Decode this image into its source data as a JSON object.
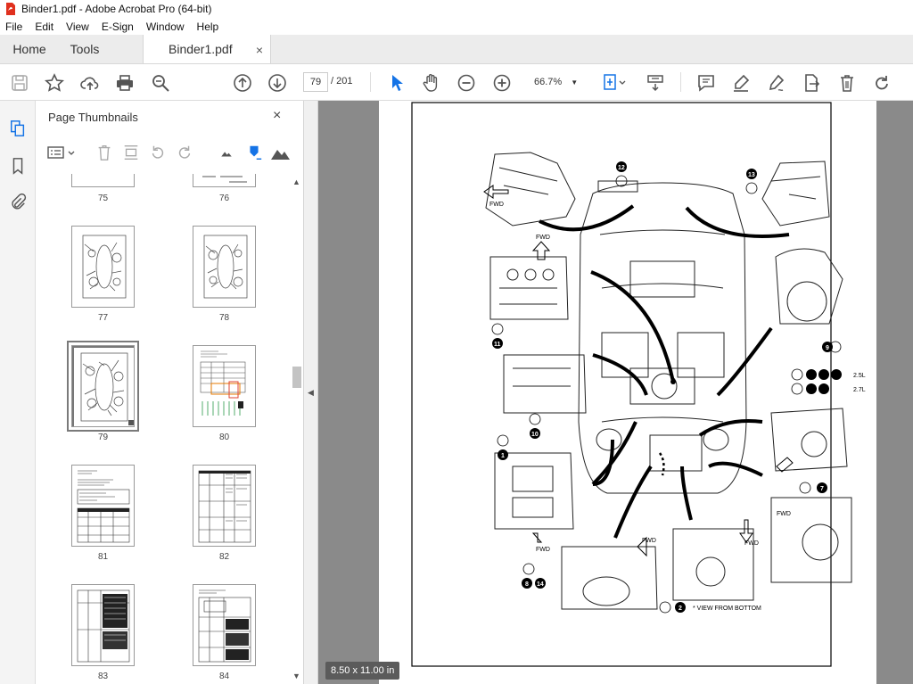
{
  "window": {
    "title": "Binder1.pdf - Adobe Acrobat Pro (64-bit)"
  },
  "menu": [
    "File",
    "Edit",
    "View",
    "E-Sign",
    "Window",
    "Help"
  ],
  "tabs": {
    "home": "Home",
    "tools": "Tools",
    "document": "Binder1.pdf",
    "close": "×"
  },
  "toolbar": {
    "page_current": "79",
    "page_total": "/ 201",
    "zoom": "66.7%"
  },
  "panel": {
    "title": "Page Thumbnails",
    "close": "×",
    "thumbnails": [
      {
        "label": "75"
      },
      {
        "label": "76"
      },
      {
        "label": "77"
      },
      {
        "label": "78"
      },
      {
        "label": "79",
        "selected": true
      },
      {
        "label": "80"
      },
      {
        "label": "81"
      },
      {
        "label": "82"
      },
      {
        "label": "83"
      },
      {
        "label": "84"
      }
    ]
  },
  "page_size": "8.50 x 11.00 in",
  "diagram": {
    "fwd": "FWD",
    "view_note": "* VIEW FROM BOTTOM",
    "labels": [
      "12",
      "13",
      "11",
      "9",
      "10",
      "1",
      "7",
      "2",
      "8",
      "14"
    ],
    "engine_2_5": "2.5L",
    "engine_2_7": "2.7L"
  },
  "colors": {
    "accent": "#1473e6",
    "toolbar_icon": "#555555",
    "doc_bg": "#8a8a8a",
    "badge_bg": "#5b5b5b"
  }
}
